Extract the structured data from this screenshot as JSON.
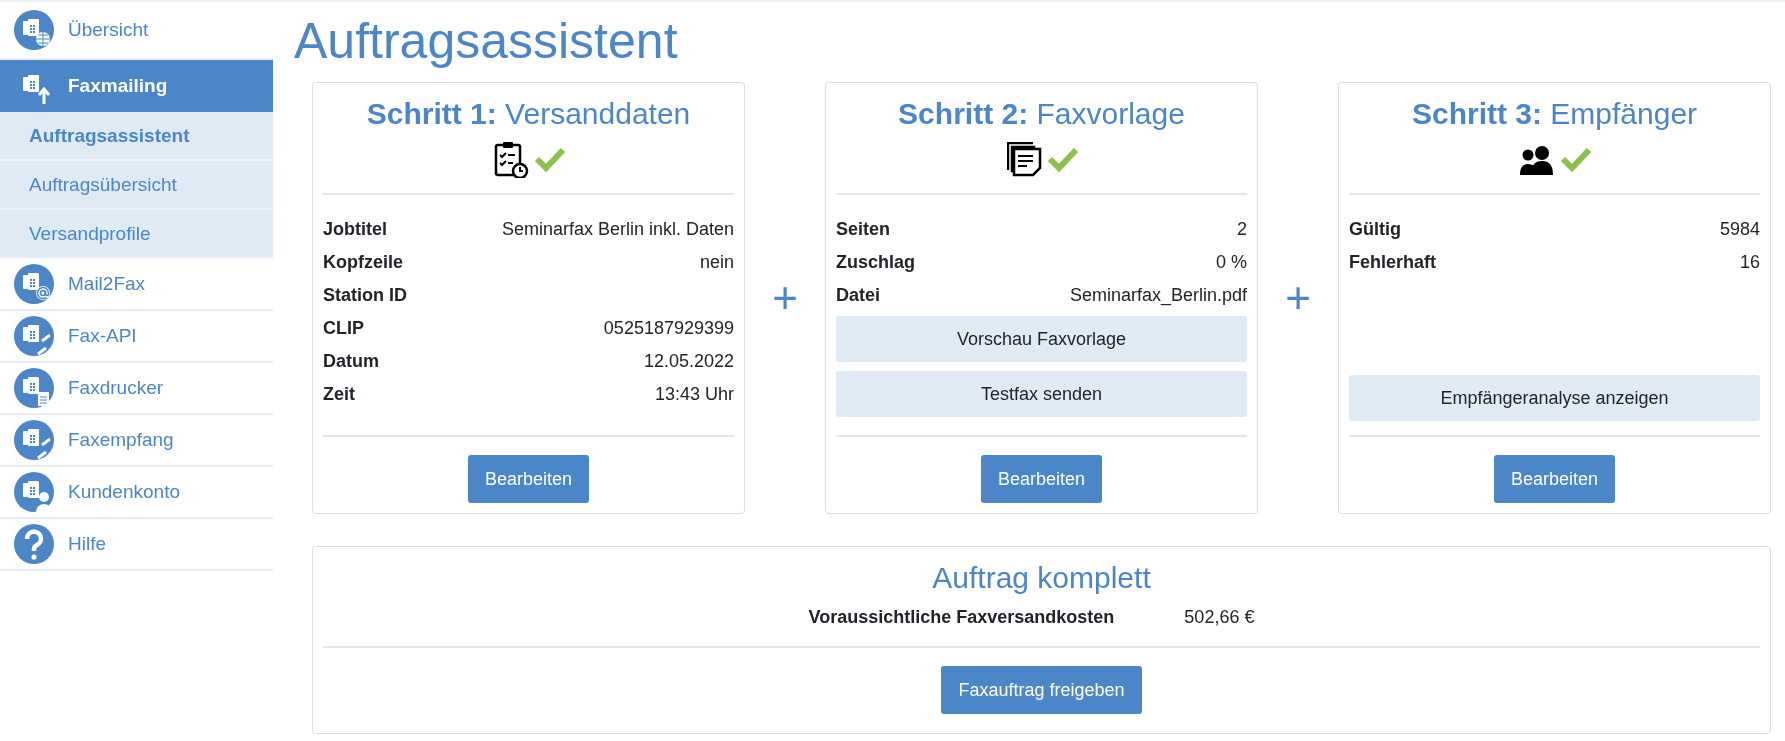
{
  "sidebar": {
    "items": [
      {
        "label": "Übersicht",
        "selected": false
      },
      {
        "label": "Faxmailing",
        "selected": true,
        "expanded": true,
        "children": [
          {
            "label": "Auftragsassistent",
            "selected": true
          },
          {
            "label": "Auftragsübersicht",
            "selected": false
          },
          {
            "label": "Versandprofile",
            "selected": false
          }
        ]
      },
      {
        "label": "Mail2Fax",
        "selected": false
      },
      {
        "label": "Fax-API",
        "selected": false
      },
      {
        "label": "Faxdrucker",
        "selected": false
      },
      {
        "label": "Faxempfang",
        "selected": false
      },
      {
        "label": "Kundenkonto",
        "selected": false
      },
      {
        "label": "Hilfe",
        "selected": false
      }
    ]
  },
  "page_title": "Auftragsassistent",
  "steps": [
    {
      "step_label": "Schritt 1:",
      "title": "Versanddaten",
      "complete": true,
      "fields": [
        {
          "label": "Jobtitel",
          "value": "Seminarfax Berlin inkl. Daten"
        },
        {
          "label": "Kopfzeile",
          "value": "nein"
        },
        {
          "label": "Station ID"
        },
        {
          "label": "CLIP",
          "value": "0525187929399"
        },
        {
          "label": "Datum",
          "value": "12.05.2022"
        },
        {
          "label": "Zeit",
          "value": "13:43 Uhr"
        }
      ],
      "button": "Bearbeiten"
    },
    {
      "step_label": "Schritt 2:",
      "title": "Faxvorlage",
      "complete": true,
      "fields": [
        {
          "label": "Seiten",
          "value": "2"
        },
        {
          "label": "Zuschlag",
          "value": "0 %"
        },
        {
          "label": "Datei",
          "value": "Seminarfax_Berlin.pdf"
        }
      ],
      "actions": [
        "Vorschau Faxvorlage",
        "Testfax senden"
      ],
      "button": "Bearbeiten"
    },
    {
      "step_label": "Schritt 3:",
      "title": "Empfänger",
      "complete": true,
      "fields": [
        {
          "label": "Gültig",
          "value": "5984"
        },
        {
          "label": "Fehlerhaft",
          "value": "16"
        }
      ],
      "actions": [
        "Empfängeranalyse anzeigen"
      ],
      "button": "Bearbeiten"
    }
  ],
  "connectors": [
    "+",
    "+"
  ],
  "summary": {
    "title": "Auftrag komplett",
    "cost_label": "Voraussichtliche Faxversandkosten",
    "cost_value": "502,66 €",
    "button": "Faxauftrag freigeben"
  }
}
